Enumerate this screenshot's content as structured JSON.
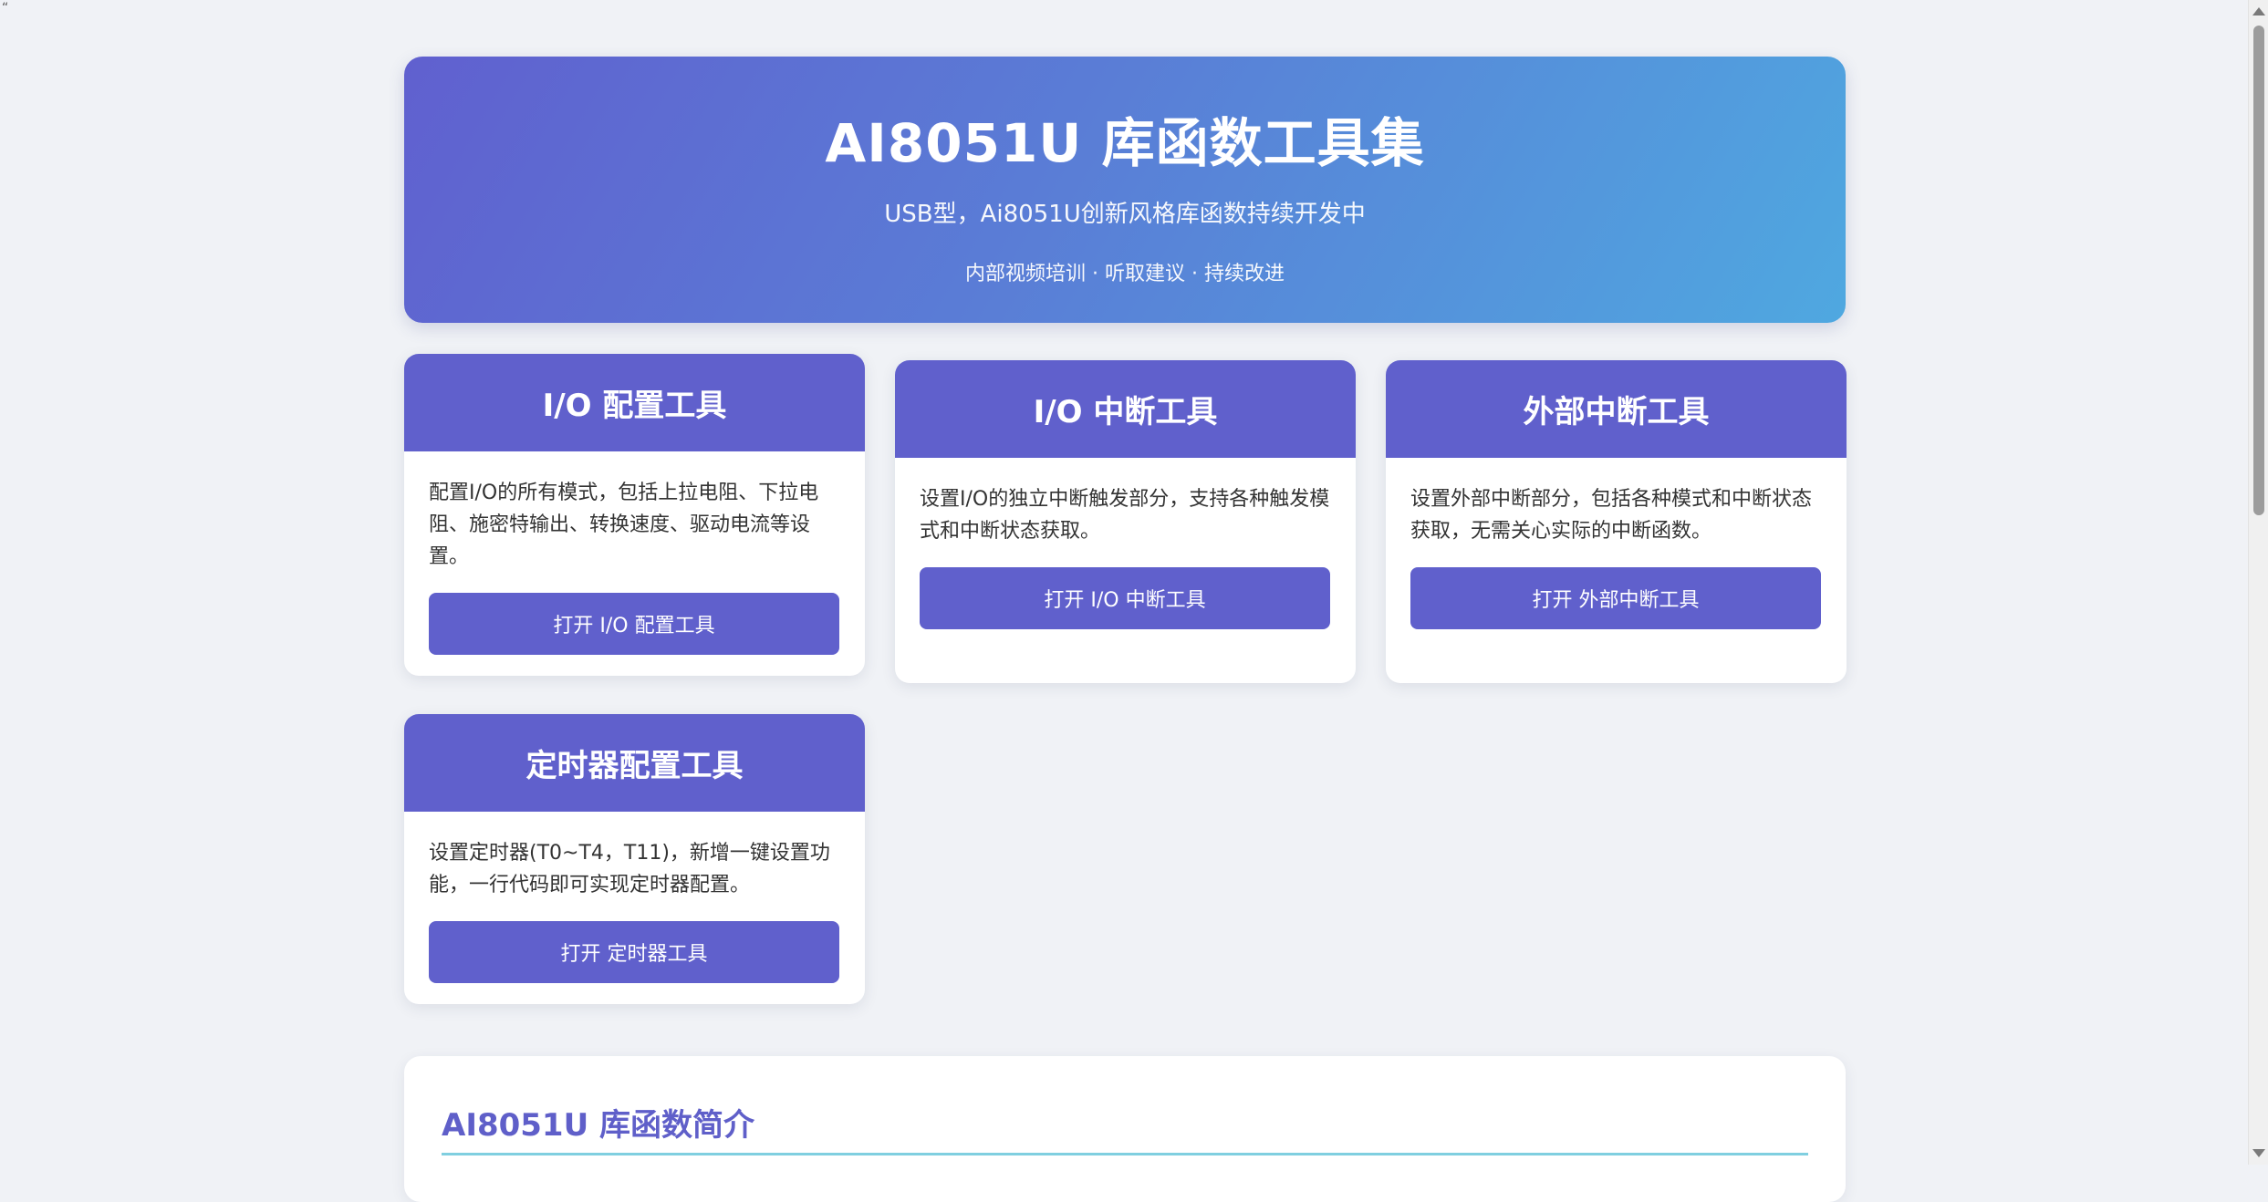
{
  "stray_text": "“",
  "hero": {
    "title": "AI8051U 库函数工具集",
    "subtitle": "USB型，Ai8051U创新风格库函数持续开发中",
    "tagline": "内部视频培训 · 听取建议 · 持续改进"
  },
  "tools": [
    {
      "title": "I/O 配置工具",
      "description": "配置I/O的所有模式，包括上拉电阻、下拉电阻、施密特输出、转换速度、驱动电流等设置。",
      "button_label": "打开 I/O 配置工具"
    },
    {
      "title": "I/O 中断工具",
      "description": "设置I/O的独立中断触发部分，支持各种触发模式和中断状态获取。",
      "button_label": "打开 I/O 中断工具"
    },
    {
      "title": "外部中断工具",
      "description": "设置外部中断部分，包括各种模式和中断状态获取，无需关心实际的中断函数。",
      "button_label": "打开 外部中断工具"
    },
    {
      "title": "定时器配置工具",
      "description": "设置定时器(T0~T4，T11)，新增一键设置功能，一行代码即可实现定时器配置。",
      "button_label": "打开 定时器工具"
    }
  ],
  "intro": {
    "title": "AI8051U 库函数简介"
  },
  "colors": {
    "accent": "#6060cc",
    "hero_gradient_start": "#6060cf",
    "hero_gradient_end": "#4fa8e0",
    "intro_rule": "#80cfe0",
    "background": "#f0f2f6"
  }
}
